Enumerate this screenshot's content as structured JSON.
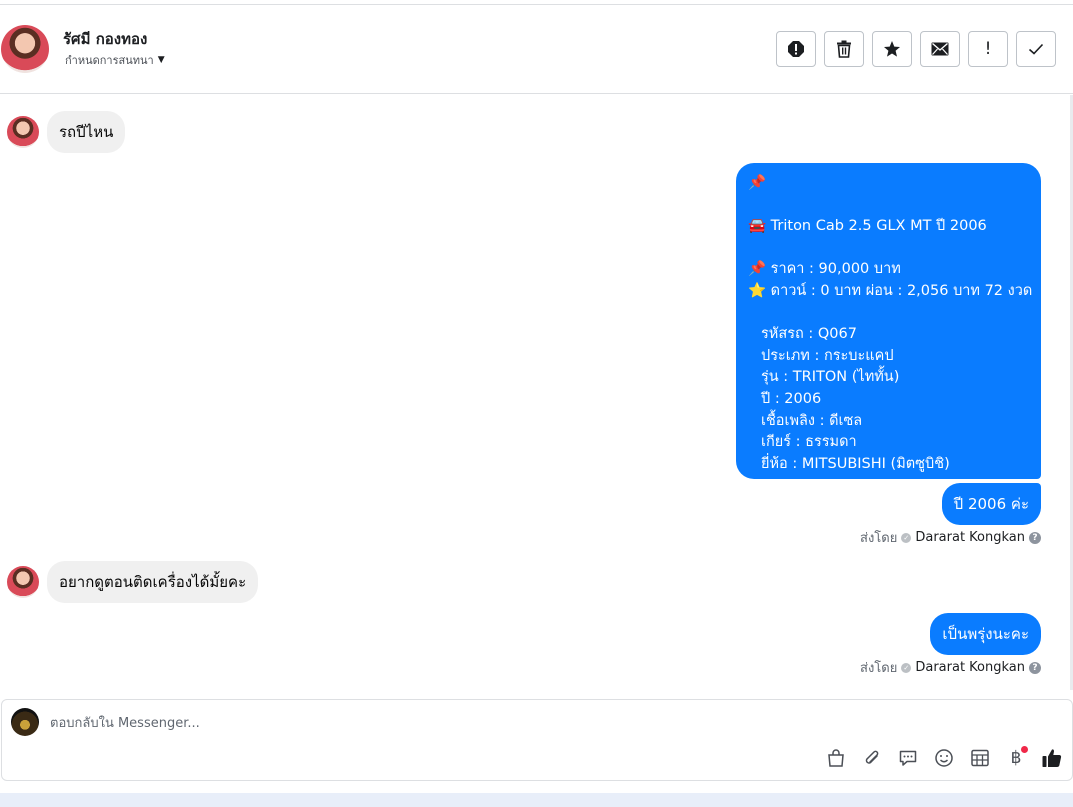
{
  "header": {
    "contact_name": "รัศมี กองทอง",
    "assign_label": "กำหนดการสนทนา",
    "toolbar_icons": [
      "spam-icon",
      "trash-icon",
      "star-icon",
      "envelope-icon",
      "exclamation-icon",
      "check-icon"
    ]
  },
  "messages": {
    "in_1": "รถปีไหน",
    "card": {
      "line_1": "📌",
      "line_2": "🚘 Triton Cab 2.5 GLX MT ปี 2006",
      "line_3": "📌 ราคา : 90,000 บาท",
      "line_4": "⭐ ดาวน์ : 0 บาท ผ่อน : 2,056 บาท 72 งวด",
      "line_5": "รหัสรถ : Q067",
      "line_6": "ประเภท : กระบะแคป",
      "line_7": "รุ่น : TRITON (ไททั้น)",
      "line_8": "ปี : 2006",
      "line_9": "เชื้อเพลิง : ดีเซล",
      "line_10": "เกียร์ : ธรรมดา",
      "line_11": "ยี่ห้อ : MITSUBISHI (มิตซูบิชิ)"
    },
    "out_1": "ปี 2006 ค่ะ",
    "sent_by_1": {
      "prefix": "ส่งโดย",
      "sender": "Dararat Kongkan",
      "help": "?"
    },
    "in_2": "อยากดูตอนติดเครื่องได้มั้ยคะ",
    "out_2": "เป็นพรุ่งนะคะ",
    "sent_by_2": {
      "prefix": "ส่งโดย",
      "sender": "Dararat Kongkan",
      "help": "?"
    }
  },
  "composer": {
    "placeholder": "ตอบกลับใน Messenger...",
    "currency_symbol": "฿",
    "icons": [
      "shopping-bag-icon",
      "paperclip-icon",
      "saved-reply-icon",
      "emoji-icon",
      "table-icon",
      "baht-icon",
      "thumbs-up-icon"
    ]
  },
  "colors": {
    "outgoing_bubble": "#0a7cff",
    "incoming_bubble": "#f0f0f0",
    "notification_dot": "#f02849"
  }
}
